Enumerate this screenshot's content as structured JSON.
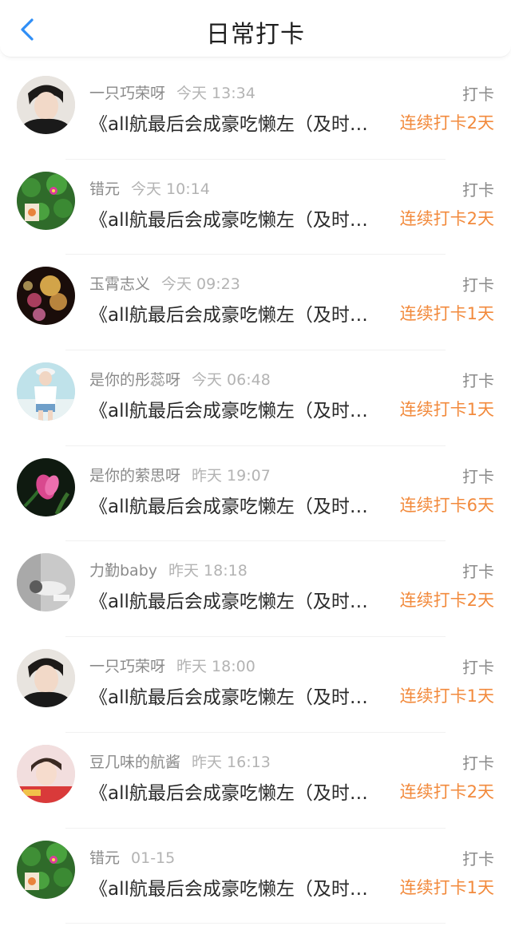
{
  "header": {
    "title": "日常打卡",
    "back_icon": "chevron-left-icon",
    "accent": "#2f8ef6"
  },
  "colors": {
    "streak": "#f28a3c",
    "name": "#8a8a8a",
    "time": "#b3b3b3"
  },
  "items": [
    {
      "name": "一只巧荣呀",
      "time": "今天 13:34",
      "tag": "打卡",
      "content": "《all航最后会成豪吃懒左（及时…",
      "streak": "连续打卡2天",
      "avatar": "boy-photo"
    },
    {
      "name": "错元",
      "time": "今天 10:14",
      "tag": "打卡",
      "content": "《all航最后会成豪吃懒左（及时…",
      "streak": "连续打卡2天",
      "avatar": "clover-photo"
    },
    {
      "name": "玉霄志义",
      "time": "今天 09:23",
      "tag": "打卡",
      "content": "《all航最后会成豪吃懒左（及时…",
      "streak": "连续打卡1天",
      "avatar": "bokeh-photo"
    },
    {
      "name": "是你的彤蕊呀",
      "time": "今天 06:48",
      "tag": "打卡",
      "content": "《all航最后会成豪吃懒左（及时…",
      "streak": "连续打卡1天",
      "avatar": "girl-photo"
    },
    {
      "name": "是你的萦思呀",
      "time": "昨天 19:07",
      "tag": "打卡",
      "content": "《all航最后会成豪吃懒左（及时…",
      "streak": "连续打卡6天",
      "avatar": "flower-photo"
    },
    {
      "name": "力勤baby",
      "time": "昨天 18:18",
      "tag": "打卡",
      "content": "《all航最后会成豪吃懒左（及时…",
      "streak": "连续打卡2天",
      "avatar": "gray-photo"
    },
    {
      "name": "一只巧荣呀",
      "time": "昨天 18:00",
      "tag": "打卡",
      "content": "《all航最后会成豪吃懒左（及时…",
      "streak": "连续打卡1天",
      "avatar": "boy-photo"
    },
    {
      "name": "豆几味的航酱",
      "time": "昨天 16:13",
      "tag": "打卡",
      "content": "《all航最后会成豪吃懒左（及时…",
      "streak": "连续打卡2天",
      "avatar": "kid-photo"
    },
    {
      "name": "错元",
      "time": "01-15",
      "tag": "打卡",
      "content": "《all航最后会成豪吃懒左（及时…",
      "streak": "连续打卡1天",
      "avatar": "clover-photo"
    }
  ]
}
